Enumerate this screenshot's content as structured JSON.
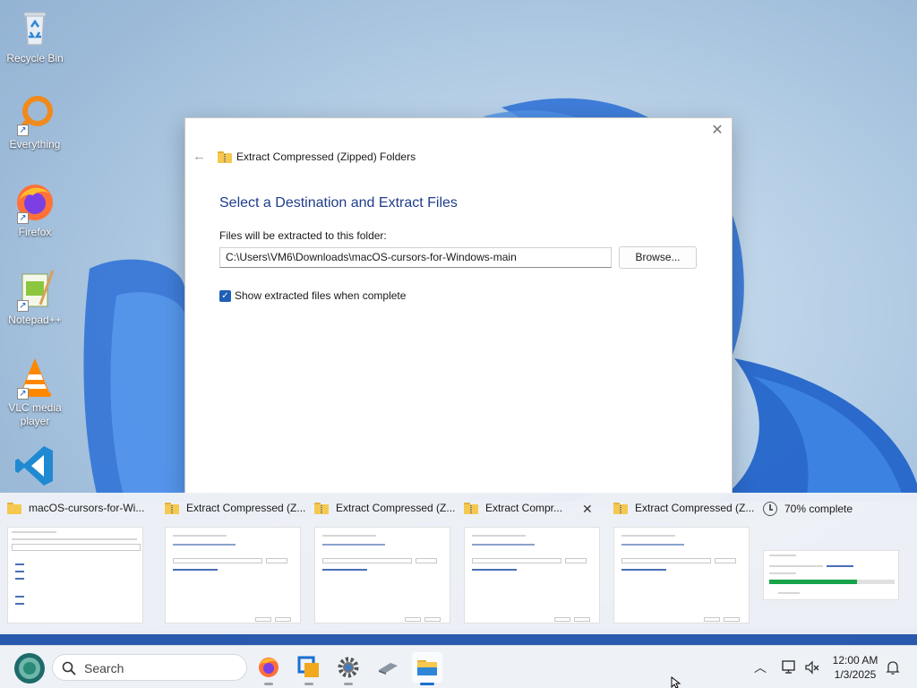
{
  "desktop": {
    "icons": [
      {
        "label": "Recycle Bin",
        "icon": "recycle-bin-icon"
      },
      {
        "label": "Everything",
        "icon": "everything-search-icon"
      },
      {
        "label": "Firefox",
        "icon": "firefox-icon"
      },
      {
        "label": "Notepad++",
        "icon": "notepad-plus-plus-icon"
      },
      {
        "label": "VLC media player",
        "icon": "vlc-icon"
      },
      {
        "label": "",
        "icon": "vscode-icon"
      }
    ]
  },
  "dialog": {
    "title": "Extract Compressed (Zipped) Folders",
    "heading": "Select a Destination and Extract Files",
    "path_label": "Files will be extracted to this folder:",
    "path_value": "C:\\Users\\VM6\\Downloads\\macOS-cursors-for-Windows-main",
    "browse_label": "Browse...",
    "checkbox_label": "Show extracted files when complete",
    "checkbox_checked": true
  },
  "switcher": {
    "items": [
      {
        "title": "macOS-cursors-for-Wi..."
      },
      {
        "title": "Extract Compressed (Z..."
      },
      {
        "title": "Extract Compressed (Z..."
      },
      {
        "title": "Extract Compr..."
      },
      {
        "title": "Extract Compressed (Z..."
      },
      {
        "title": "70% complete"
      }
    ],
    "progress": 0.7
  },
  "taskbar": {
    "search_placeholder": "Search",
    "clock": {
      "time": "12:00 AM",
      "date": "1/3/2025"
    }
  },
  "colors": {
    "accent": "#1f5fb5",
    "heading": "#1f3d8a",
    "progress": "#16a34a"
  }
}
